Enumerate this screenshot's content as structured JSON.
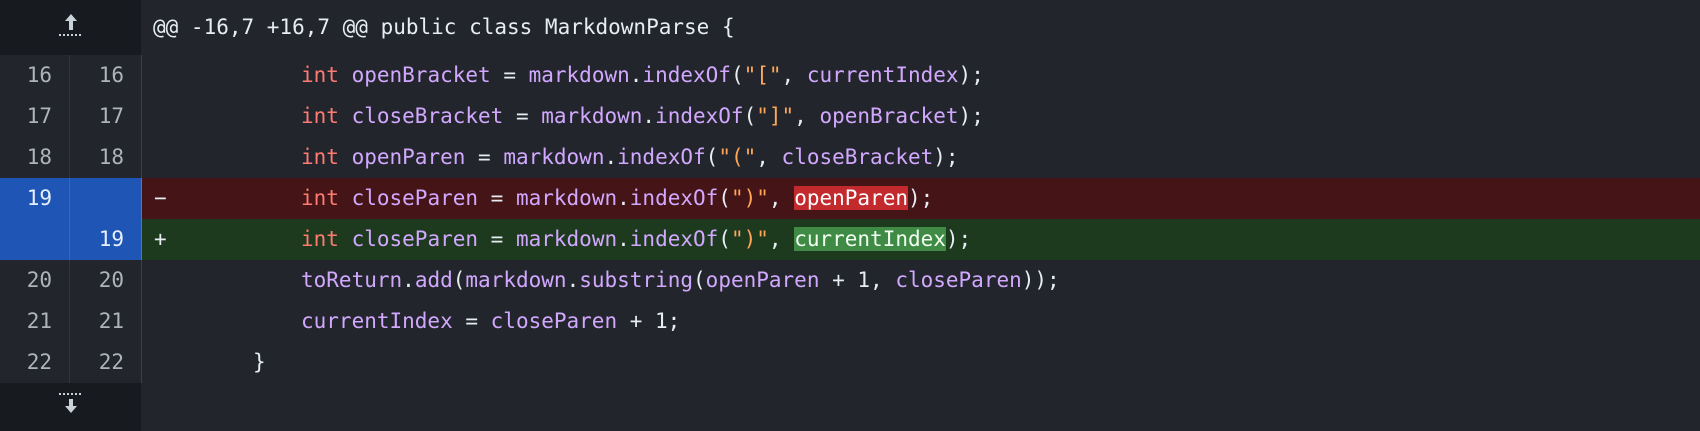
{
  "hunk_header": "@@ -16,7 +16,7 @@ public class MarkdownParse {",
  "expand_up_icon": "expand-up-icon",
  "expand_down_icon": "expand-down-icon",
  "lines": [
    {
      "old": "16",
      "new": "16",
      "type": "ctx",
      "marker": "",
      "tokens": [
        {
          "c": "kw",
          "t": "int"
        },
        {
          "c": "pl",
          "t": " "
        },
        {
          "c": "id",
          "t": "openBracket"
        },
        {
          "c": "pl",
          "t": " = "
        },
        {
          "c": "id",
          "t": "markdown"
        },
        {
          "c": "pl",
          "t": "."
        },
        {
          "c": "id",
          "t": "indexOf"
        },
        {
          "c": "pl",
          "t": "("
        },
        {
          "c": "str",
          "t": "\"[\""
        },
        {
          "c": "pl",
          "t": ", "
        },
        {
          "c": "id",
          "t": "currentIndex"
        },
        {
          "c": "pl",
          "t": ");"
        }
      ]
    },
    {
      "old": "17",
      "new": "17",
      "type": "ctx",
      "marker": "",
      "tokens": [
        {
          "c": "kw",
          "t": "int"
        },
        {
          "c": "pl",
          "t": " "
        },
        {
          "c": "id",
          "t": "closeBracket"
        },
        {
          "c": "pl",
          "t": " = "
        },
        {
          "c": "id",
          "t": "markdown"
        },
        {
          "c": "pl",
          "t": "."
        },
        {
          "c": "id",
          "t": "indexOf"
        },
        {
          "c": "pl",
          "t": "("
        },
        {
          "c": "str",
          "t": "\"]\""
        },
        {
          "c": "pl",
          "t": ", "
        },
        {
          "c": "id",
          "t": "openBracket"
        },
        {
          "c": "pl",
          "t": ");"
        }
      ]
    },
    {
      "old": "18",
      "new": "18",
      "type": "ctx",
      "marker": "",
      "tokens": [
        {
          "c": "kw",
          "t": "int"
        },
        {
          "c": "pl",
          "t": " "
        },
        {
          "c": "id",
          "t": "openParen"
        },
        {
          "c": "pl",
          "t": " = "
        },
        {
          "c": "id",
          "t": "markdown"
        },
        {
          "c": "pl",
          "t": "."
        },
        {
          "c": "id",
          "t": "indexOf"
        },
        {
          "c": "pl",
          "t": "("
        },
        {
          "c": "str",
          "t": "\"(\""
        },
        {
          "c": "pl",
          "t": ", "
        },
        {
          "c": "id",
          "t": "closeBracket"
        },
        {
          "c": "pl",
          "t": ");"
        }
      ]
    },
    {
      "old": "19",
      "new": "",
      "type": "del",
      "marker": "−",
      "tokens": [
        {
          "c": "kw",
          "t": "int"
        },
        {
          "c": "pl",
          "t": " "
        },
        {
          "c": "id",
          "t": "closeParen"
        },
        {
          "c": "pl",
          "t": " = "
        },
        {
          "c": "id",
          "t": "markdown"
        },
        {
          "c": "pl",
          "t": "."
        },
        {
          "c": "id",
          "t": "indexOf"
        },
        {
          "c": "pl",
          "t": "("
        },
        {
          "c": "str",
          "t": "\")\""
        },
        {
          "c": "pl",
          "t": ", "
        },
        {
          "c": "hl-del",
          "t": "openParen"
        },
        {
          "c": "pl",
          "t": ");"
        }
      ]
    },
    {
      "old": "",
      "new": "19",
      "type": "add",
      "marker": "+",
      "tokens": [
        {
          "c": "kw",
          "t": "int"
        },
        {
          "c": "pl",
          "t": " "
        },
        {
          "c": "id",
          "t": "closeParen"
        },
        {
          "c": "pl",
          "t": " = "
        },
        {
          "c": "id",
          "t": "markdown"
        },
        {
          "c": "pl",
          "t": "."
        },
        {
          "c": "id",
          "t": "indexOf"
        },
        {
          "c": "pl",
          "t": "("
        },
        {
          "c": "str",
          "t": "\")\""
        },
        {
          "c": "pl",
          "t": ", "
        },
        {
          "c": "hl-add",
          "t": "currentIndex"
        },
        {
          "c": "pl",
          "t": ");"
        }
      ]
    },
    {
      "old": "20",
      "new": "20",
      "type": "ctx",
      "marker": "",
      "tokens": [
        {
          "c": "id",
          "t": "toReturn"
        },
        {
          "c": "pl",
          "t": "."
        },
        {
          "c": "id",
          "t": "add"
        },
        {
          "c": "pl",
          "t": "("
        },
        {
          "c": "id",
          "t": "markdown"
        },
        {
          "c": "pl",
          "t": "."
        },
        {
          "c": "id",
          "t": "substring"
        },
        {
          "c": "pl",
          "t": "("
        },
        {
          "c": "id",
          "t": "openParen"
        },
        {
          "c": "pl",
          "t": " + 1, "
        },
        {
          "c": "id",
          "t": "closeParen"
        },
        {
          "c": "pl",
          "t": "));"
        }
      ]
    },
    {
      "old": "21",
      "new": "21",
      "type": "ctx",
      "marker": "",
      "tokens": [
        {
          "c": "id",
          "t": "currentIndex"
        },
        {
          "c": "pl",
          "t": " = "
        },
        {
          "c": "id",
          "t": "closeParen"
        },
        {
          "c": "pl",
          "t": " + 1;"
        }
      ]
    },
    {
      "old": "22",
      "new": "22",
      "type": "ctx",
      "marker": "",
      "dedent": true,
      "tokens": [
        {
          "c": "pl",
          "t": "}"
        }
      ]
    }
  ]
}
